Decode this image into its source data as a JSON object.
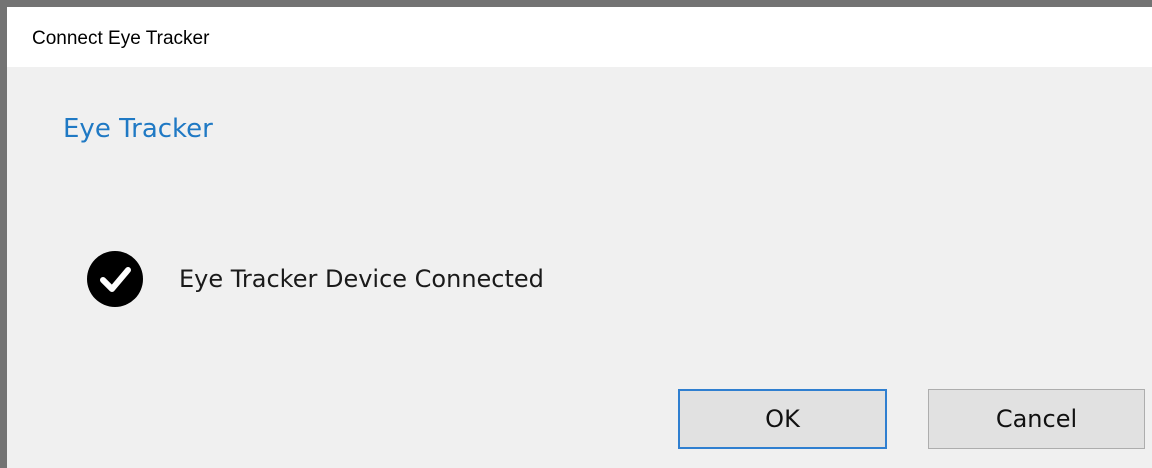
{
  "window": {
    "title": "Connect Eye Tracker"
  },
  "content": {
    "heading": "Eye Tracker",
    "status_icon": "checkmark-circle-icon",
    "status_text": "Eye Tracker Device Connected"
  },
  "buttons": {
    "ok_label": "OK",
    "cancel_label": "Cancel"
  },
  "colors": {
    "heading": "#1f79c4",
    "dialog_background": "#f0f0f0",
    "titlebar_background": "#ffffff",
    "default_button_border": "#2f7fd0",
    "icon": "#000000"
  }
}
